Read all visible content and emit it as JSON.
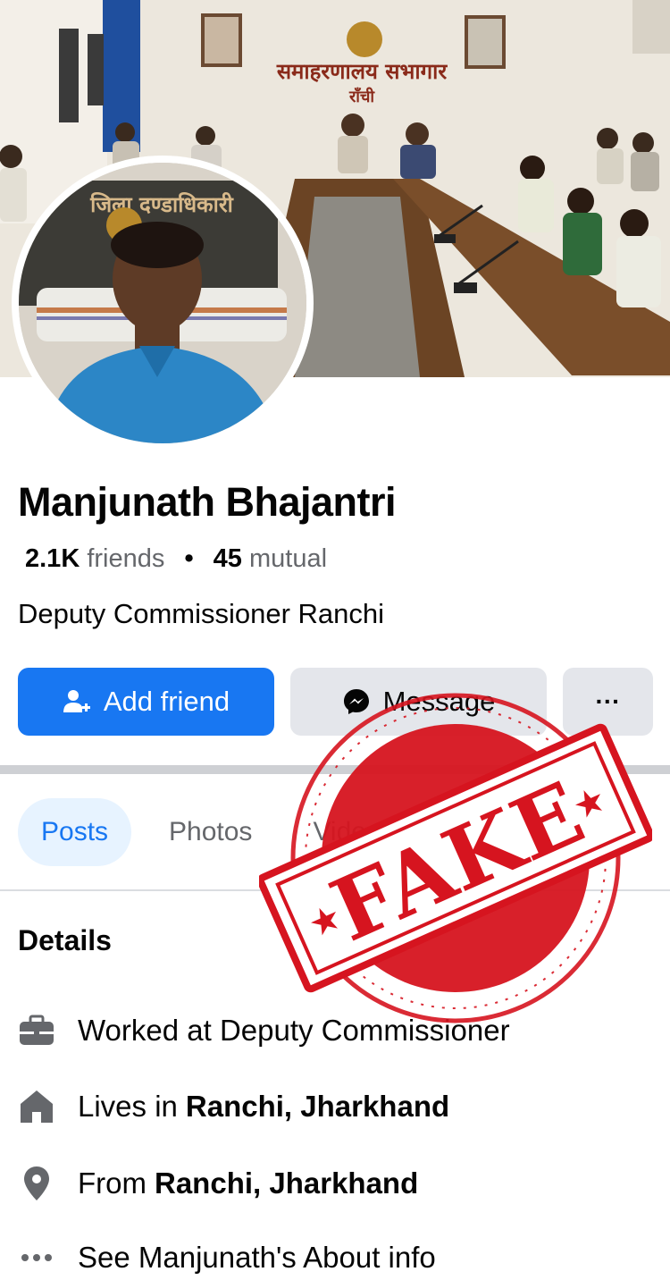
{
  "profile": {
    "name": "Manjunath Bhajantri",
    "friends_count": "2.1K",
    "friends_label": "friends",
    "mutual_count": "45",
    "mutual_label": "mutual",
    "bio": "Deputy Commissioner Ranchi"
  },
  "cover": {
    "banner_line1": "समाहरणालय सभागार",
    "banner_line2": "राँची"
  },
  "avatar": {
    "sign_text": "जिला दण्डाधिकारी"
  },
  "actions": {
    "add_friend": "Add friend",
    "message": "Message",
    "more": "···"
  },
  "tabs": [
    {
      "label": "Posts",
      "active": true
    },
    {
      "label": "Photos",
      "active": false
    },
    {
      "label": "Videos",
      "active": false
    }
  ],
  "details": {
    "title": "Details",
    "work": "Worked at Deputy Commissioner",
    "lives_prefix": "Lives in",
    "lives_place": "Ranchi, Jharkhand",
    "from_prefix": "From",
    "from_place": "Ranchi, Jharkhand",
    "about": "See Manjunath's About info"
  },
  "stamp": {
    "text": "FAKE"
  },
  "colors": {
    "accent": "#1877f2",
    "stamp_red": "#d6141f",
    "button_grey": "#e4e6eb",
    "muted_text": "#65676b"
  },
  "icons": [
    "add-user-icon",
    "messenger-icon",
    "briefcase-icon",
    "home-icon",
    "location-pin-icon",
    "ellipsis-icon"
  ]
}
